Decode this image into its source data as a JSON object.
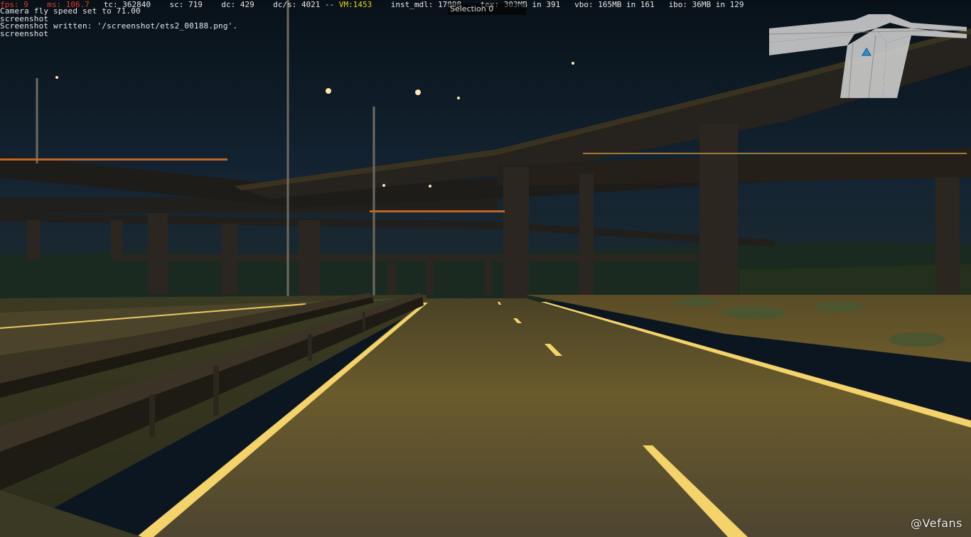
{
  "stats": {
    "fps_label": "fps:",
    "fps": "9",
    "ms_label": "ms:",
    "ms": "106.7",
    "tc": "tc: 362840",
    "sc": "sc: 719",
    "dc": "dc: 429",
    "dcs": "dc/s: 4021 --",
    "vm": "VM:1453",
    "inst": "inst_mdl: 17898",
    "tex": "tex: 303MB in 391",
    "vbo": "vbo: 165MB in 161",
    "ibo": "ibo: 36MB in 129"
  },
  "console": {
    "lines": [
      "Camera fly speed set to 71.00",
      "screenshot",
      "Screenshot written: '/screenshot/ets2_00188.png'.",
      "screenshot"
    ]
  },
  "selection_label": "Selection  0",
  "watermark": "@Vefans",
  "colors": {
    "sky": "#0b1620",
    "road": "#5e5128",
    "lane_marking": "#f3d36a",
    "bridge": "#2a2620",
    "minimap": "#d9d9d9",
    "player_marker": "#2b8fd6"
  },
  "icons": [
    "player-position-icon"
  ]
}
